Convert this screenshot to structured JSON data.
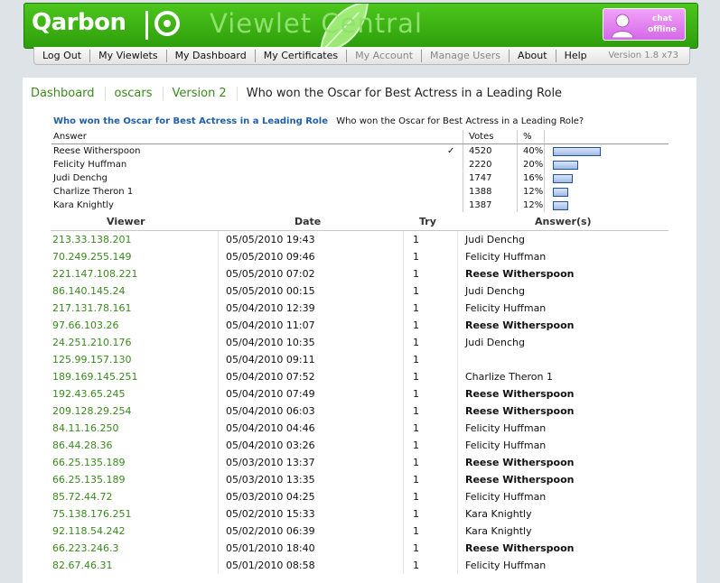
{
  "brand": {
    "logo": "Qarbon",
    "app_title": "Viewlet Central",
    "chat_line1": "chat",
    "chat_line2": "offline",
    "colors": {
      "banner": "#3aad14",
      "link": "#3a8a1e",
      "question_link": "#1f5fa8",
      "chat": "#e489f0"
    }
  },
  "nav": {
    "items": [
      {
        "label": "Log Out",
        "enabled": true
      },
      {
        "label": "My Viewlets",
        "enabled": true
      },
      {
        "label": "My Dashboard",
        "enabled": true
      },
      {
        "label": "My Certificates",
        "enabled": true
      },
      {
        "label": "My Account",
        "enabled": false
      },
      {
        "label": "Manage Users",
        "enabled": false
      },
      {
        "label": "About",
        "enabled": true
      },
      {
        "label": "Help",
        "enabled": true
      }
    ],
    "version": "Version 1.8 x73"
  },
  "breadcrumb": {
    "items": [
      "Dashboard",
      "oscars",
      "Version 2"
    ],
    "current": "Who won the Oscar for Best Actress in a Leading Role"
  },
  "question": {
    "title": "Who won the Oscar for Best Actress in a Leading Role",
    "text": "Who won the Oscar for Best Actress in a Leading Role?"
  },
  "summary": {
    "headers": {
      "answer": "Answer",
      "votes": "Votes",
      "pct": "%"
    },
    "rows": [
      {
        "answer": "Reese Witherspoon",
        "correct_mark": "✓",
        "votes": "4520",
        "pct": "40%",
        "share": 0.4
      },
      {
        "answer": "Felicity Huffman",
        "correct_mark": "",
        "votes": "2220",
        "pct": "20%",
        "share": 0.2
      },
      {
        "answer": "Judi Denchg",
        "correct_mark": "",
        "votes": "1747",
        "pct": "16%",
        "share": 0.16
      },
      {
        "answer": "Charlize Theron 1",
        "correct_mark": "",
        "votes": "1388",
        "pct": "12%",
        "share": 0.12
      },
      {
        "answer": "Kara Knightly",
        "correct_mark": "",
        "votes": "1387",
        "pct": "12%",
        "share": 0.12
      }
    ]
  },
  "viewers": {
    "headers": {
      "viewer": "Viewer",
      "date": "Date",
      "try": "Try",
      "answers": "Answer(s)"
    },
    "rows": [
      {
        "viewer": "213.33.138.201",
        "date": "05/05/2010 19:43",
        "try": "1",
        "answer": "Judi Denchg",
        "correct": false
      },
      {
        "viewer": "70.249.255.149",
        "date": "05/05/2010 09:46",
        "try": "1",
        "answer": "Felicity Huffman",
        "correct": false
      },
      {
        "viewer": "221.147.108.221",
        "date": "05/05/2010 07:02",
        "try": "1",
        "answer": "Reese Witherspoon",
        "correct": true
      },
      {
        "viewer": "86.140.145.24",
        "date": "05/05/2010 00:15",
        "try": "1",
        "answer": "Judi Denchg",
        "correct": false
      },
      {
        "viewer": "217.131.78.161",
        "date": "05/04/2010 12:39",
        "try": "1",
        "answer": "Felicity Huffman",
        "correct": false
      },
      {
        "viewer": "97.66.103.26",
        "date": "05/04/2010 11:07",
        "try": "1",
        "answer": "Reese Witherspoon",
        "correct": true
      },
      {
        "viewer": "24.251.210.176",
        "date": "05/04/2010 10:35",
        "try": "1",
        "answer": "Judi Denchg",
        "correct": false
      },
      {
        "viewer": "125.99.157.130",
        "date": "05/04/2010 09:11",
        "try": "1",
        "answer": "",
        "correct": false
      },
      {
        "viewer": "189.169.145.251",
        "date": "05/04/2010 07:52",
        "try": "1",
        "answer": "Charlize Theron 1",
        "correct": false
      },
      {
        "viewer": "192.43.65.245",
        "date": "05/04/2010 07:49",
        "try": "1",
        "answer": "Reese Witherspoon",
        "correct": true
      },
      {
        "viewer": "209.128.29.254",
        "date": "05/04/2010 06:03",
        "try": "1",
        "answer": "Reese Witherspoon",
        "correct": true
      },
      {
        "viewer": "84.11.16.250",
        "date": "05/04/2010 04:46",
        "try": "1",
        "answer": "Felicity Huffman",
        "correct": false
      },
      {
        "viewer": "86.44.28.36",
        "date": "05/04/2010 03:26",
        "try": "1",
        "answer": "Felicity Huffman",
        "correct": false
      },
      {
        "viewer": "66.25.135.189",
        "date": "05/03/2010 13:37",
        "try": "1",
        "answer": "Reese Witherspoon",
        "correct": true
      },
      {
        "viewer": "66.25.135.189",
        "date": "05/03/2010 13:35",
        "try": "1",
        "answer": "Reese Witherspoon",
        "correct": true
      },
      {
        "viewer": "85.72.44.72",
        "date": "05/03/2010 04:25",
        "try": "1",
        "answer": "Felicity Huffman",
        "correct": false
      },
      {
        "viewer": "75.138.176.251",
        "date": "05/02/2010 15:33",
        "try": "1",
        "answer": "Kara Knightly",
        "correct": false
      },
      {
        "viewer": "92.118.54.242",
        "date": "05/02/2010 06:39",
        "try": "1",
        "answer": "Kara Knightly",
        "correct": false
      },
      {
        "viewer": "66.223.246.3",
        "date": "05/01/2010 18:40",
        "try": "1",
        "answer": "Reese Witherspoon",
        "correct": true
      },
      {
        "viewer": "82.67.46.31",
        "date": "05/01/2010 08:58",
        "try": "1",
        "answer": "Felicity Huffman",
        "correct": false
      }
    ]
  }
}
